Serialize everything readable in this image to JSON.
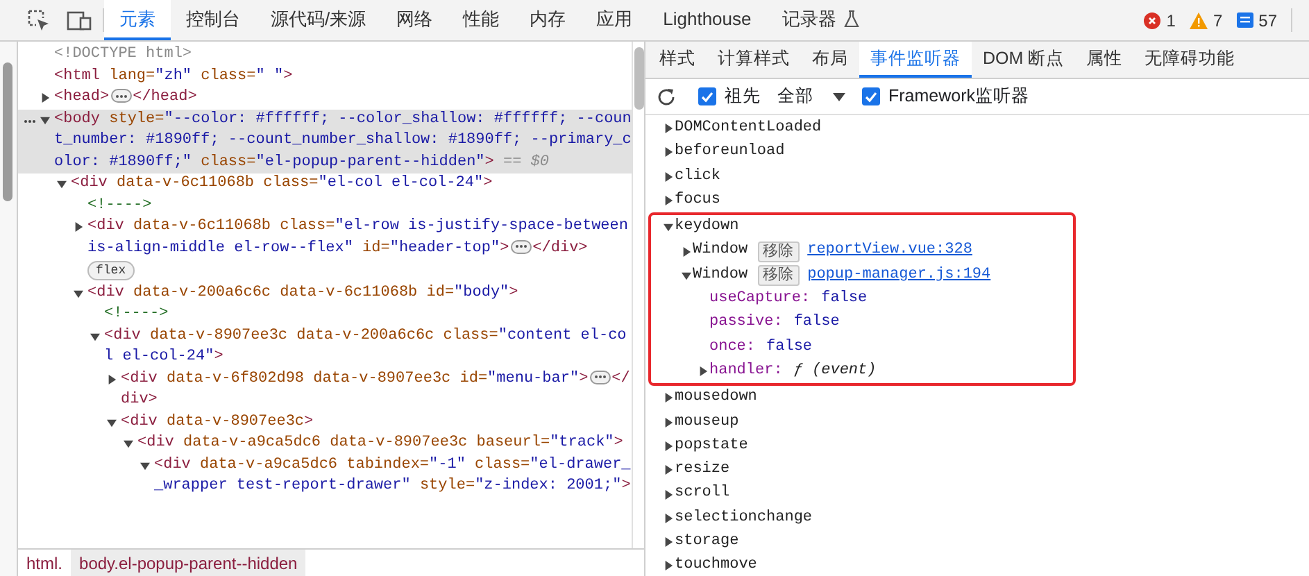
{
  "main_tabs": [
    {
      "label": "元素",
      "selected": true
    },
    {
      "label": "控制台",
      "selected": false
    },
    {
      "label": "源代码/来源",
      "selected": false
    },
    {
      "label": "网络",
      "selected": false
    },
    {
      "label": "性能",
      "selected": false
    },
    {
      "label": "内存",
      "selected": false
    },
    {
      "label": "应用",
      "selected": false
    },
    {
      "label": "Lighthouse",
      "selected": false
    },
    {
      "label": "记录器",
      "selected": false,
      "experimental": true
    }
  ],
  "counters": [
    {
      "kind": "error",
      "count": "1"
    },
    {
      "kind": "warning",
      "count": "7"
    },
    {
      "kind": "info",
      "count": "57"
    }
  ],
  "dom_tree": [
    {
      "segments": [
        {
          "kind": "doctype",
          "text": "<!DOCTYPE html>"
        }
      ]
    },
    {
      "segments": [
        {
          "kind": "tag",
          "text": "<html"
        },
        {
          "kind": "attr",
          "text": " lang="
        },
        {
          "kind": "value",
          "text": "\"zh\""
        },
        {
          "kind": "attr",
          "text": " class="
        },
        {
          "kind": "value",
          "text": "\" \""
        },
        {
          "kind": "tag",
          "text": ">"
        }
      ]
    },
    {
      "expanded": false,
      "selected": false,
      "segments": [
        {
          "kind": "tag",
          "text": "<head>"
        },
        {
          "kind": "ellipsis"
        },
        {
          "kind": "tag",
          "text": "</head>"
        }
      ]
    },
    {
      "expanded": true,
      "selected": true,
      "segments": [
        {
          "kind": "tag",
          "text": "<body"
        },
        {
          "kind": "attr",
          "text": " style="
        },
        {
          "kind": "value",
          "text": "\"--color: #ffffff; --color_shallow: #ffffff; --count_number: #1890ff; --count_number_shallow: #1890ff; --primary_color: #1890ff;\""
        },
        {
          "kind": "attr",
          "text": " class="
        },
        {
          "kind": "value",
          "text": "\"el-popup-parent--hidden\""
        },
        {
          "kind": "tag",
          "text": ">"
        },
        {
          "kind": "marker",
          "text": " == $0"
        }
      ],
      "children": [
        {
          "expanded": true,
          "selected": false,
          "segments": [
            {
              "kind": "tag",
              "text": "<div"
            },
            {
              "kind": "attr",
              "text": " data-v-6c11068b class="
            },
            {
              "kind": "value",
              "text": "\"el-col el-col-24\""
            },
            {
              "kind": "tag",
              "text": ">"
            }
          ],
          "children": [
            {
              "segments": [
                {
                  "kind": "comment",
                  "text": "<!---->"
                }
              ]
            },
            {
              "expanded": false,
              "selected": false,
              "badge": "flex",
              "segments": [
                {
                  "kind": "tag",
                  "text": "<div"
                },
                {
                  "kind": "attr",
                  "text": " data-v-6c11068b class="
                },
                {
                  "kind": "value",
                  "text": "\"el-row is-justify-space-between is-align-middle el-row--flex\""
                },
                {
                  "kind": "attr",
                  "text": " id="
                },
                {
                  "kind": "value",
                  "text": "\"header-top\""
                },
                {
                  "kind": "tag",
                  "text": ">"
                },
                {
                  "kind": "ellipsis"
                },
                {
                  "kind": "tag",
                  "text": "</div>"
                }
              ]
            },
            {
              "expanded": true,
              "selected": false,
              "segments": [
                {
                  "kind": "tag",
                  "text": "<div"
                },
                {
                  "kind": "attr",
                  "text": " data-v-200a6c6c data-v-6c11068b id="
                },
                {
                  "kind": "value",
                  "text": "\"body\""
                },
                {
                  "kind": "tag",
                  "text": ">"
                }
              ],
              "children": [
                {
                  "segments": [
                    {
                      "kind": "comment",
                      "text": "<!---->"
                    }
                  ]
                },
                {
                  "expanded": true,
                  "selected": false,
                  "segments": [
                    {
                      "kind": "tag",
                      "text": "<div"
                    },
                    {
                      "kind": "attr",
                      "text": " data-v-8907ee3c data-v-200a6c6c class="
                    },
                    {
                      "kind": "value",
                      "text": "\"content el-col el-col-24\""
                    },
                    {
                      "kind": "tag",
                      "text": ">"
                    }
                  ],
                  "children": [
                    {
                      "expanded": false,
                      "selected": false,
                      "segments": [
                        {
                          "kind": "tag",
                          "text": "<div"
                        },
                        {
                          "kind": "attr",
                          "text": " data-v-6f802d98 data-v-8907ee3c id="
                        },
                        {
                          "kind": "value",
                          "text": "\"menu-bar\""
                        },
                        {
                          "kind": "tag",
                          "text": ">"
                        },
                        {
                          "kind": "ellipsis"
                        },
                        {
                          "kind": "tag",
                          "text": "</div>"
                        }
                      ]
                    },
                    {
                      "expanded": true,
                      "selected": false,
                      "segments": [
                        {
                          "kind": "tag",
                          "text": "<div"
                        },
                        {
                          "kind": "attr",
                          "text": " data-v-8907ee3c"
                        },
                        {
                          "kind": "tag",
                          "text": ">"
                        }
                      ],
                      "children": [
                        {
                          "expanded": true,
                          "selected": false,
                          "segments": [
                            {
                              "kind": "tag",
                              "text": "<div"
                            },
                            {
                              "kind": "attr",
                              "text": " data-v-a9ca5dc6 data-v-8907ee3c baseurl="
                            },
                            {
                              "kind": "value",
                              "text": "\"track\""
                            },
                            {
                              "kind": "tag",
                              "text": ">"
                            }
                          ],
                          "children": [
                            {
                              "expanded": true,
                              "selected": false,
                              "segments": [
                                {
                                  "kind": "tag",
                                  "text": "<div"
                                },
                                {
                                  "kind": "attr",
                                  "text": " data-v-a9ca5dc6 tabindex="
                                },
                                {
                                  "kind": "value",
                                  "text": "\"-1\""
                                },
                                {
                                  "kind": "attr",
                                  "text": " class="
                                },
                                {
                                  "kind": "value",
                                  "text": "\"el-drawer__wrapper test-report-drawer\""
                                },
                                {
                                  "kind": "attr",
                                  "text": " style="
                                },
                                {
                                  "kind": "value",
                                  "text": "\"z-index: 2001;\""
                                },
                                {
                                  "kind": "tag",
                                  "text": ">"
                                }
                              ]
                            }
                          ]
                        }
                      ]
                    }
                  ]
                }
              ]
            }
          ]
        }
      ]
    }
  ],
  "breadcrumbs": [
    {
      "label": "html.",
      "selected": false
    },
    {
      "label": "body.el-popup-parent--hidden",
      "selected": true
    }
  ],
  "side_tabs": [
    {
      "label": "样式",
      "selected": false
    },
    {
      "label": "计算样式",
      "selected": false
    },
    {
      "label": "布局",
      "selected": false
    },
    {
      "label": "事件监听器",
      "selected": true
    },
    {
      "label": "DOM 断点",
      "selected": false
    },
    {
      "label": "属性",
      "selected": false
    },
    {
      "label": "无障碍功能",
      "selected": false
    }
  ],
  "toolbar": {
    "ancestors": {
      "label": "祖先",
      "checked": true
    },
    "filter": "全部",
    "framework": {
      "label": "Framework监听器",
      "checked": true
    }
  },
  "events": [
    {
      "name": "DOMContentLoaded",
      "expanded": false
    },
    {
      "name": "beforeunload",
      "expanded": false
    },
    {
      "name": "click",
      "expanded": false
    },
    {
      "name": "focus",
      "expanded": false
    },
    {
      "name": "keydown",
      "expanded": true,
      "highlighted": true,
      "listeners": [
        {
          "target": "Window",
          "expanded": false,
          "remove": "移除",
          "link": "reportView.vue:328"
        },
        {
          "target": "Window",
          "expanded": true,
          "remove": "移除",
          "link": "popup-manager.js:194",
          "properties": [
            {
              "kind": "value",
              "key": "useCapture:",
              "value": "false"
            },
            {
              "kind": "value",
              "key": "passive:",
              "value": "false"
            },
            {
              "kind": "value",
              "key": "once:",
              "value": "false"
            },
            {
              "kind": "function",
              "key": "handler:",
              "value": "ƒ (event)",
              "expanded": false
            }
          ]
        }
      ]
    },
    {
      "name": "mousedown",
      "expanded": false
    },
    {
      "name": "mouseup",
      "expanded": false
    },
    {
      "name": "popstate",
      "expanded": false
    },
    {
      "name": "resize",
      "expanded": false
    },
    {
      "name": "scroll",
      "expanded": false
    },
    {
      "name": "selectionchange",
      "expanded": false
    },
    {
      "name": "storage",
      "expanded": false
    },
    {
      "name": "touchmove",
      "expanded": false
    }
  ]
}
